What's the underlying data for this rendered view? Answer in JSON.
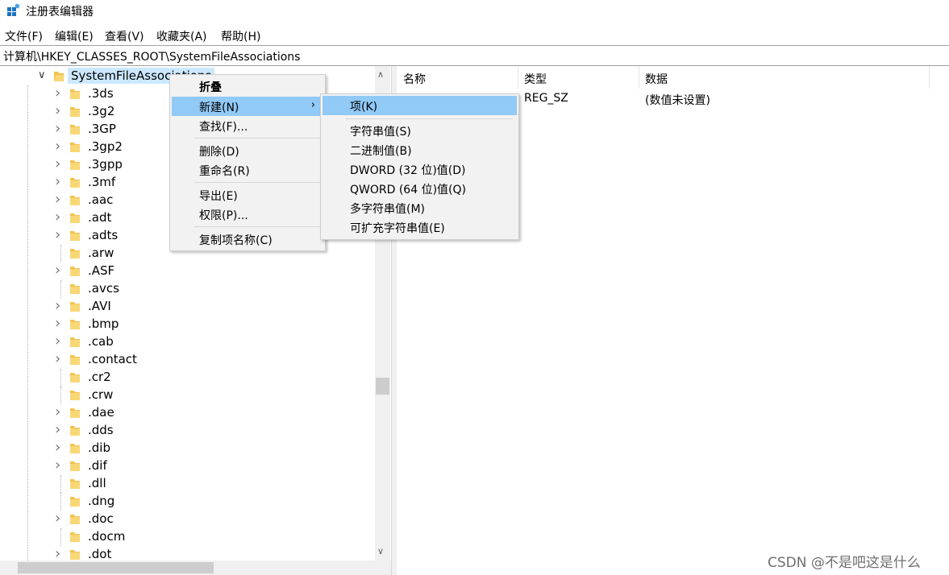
{
  "window": {
    "title": "注册表编辑器"
  },
  "menu": [
    {
      "label": "文件(F)"
    },
    {
      "label": "编辑(E)"
    },
    {
      "label": "查看(V)"
    },
    {
      "label": "收藏夹(A)"
    },
    {
      "label": "帮助(H)"
    }
  ],
  "address": "计算机\\HKEY_CLASSES_ROOT\\SystemFileAssociations",
  "tree": {
    "root_label": "SystemFileAssociations",
    "items": [
      {
        "label": ".3ds",
        "expandable": true
      },
      {
        "label": ".3g2",
        "expandable": true
      },
      {
        "label": ".3GP",
        "expandable": true
      },
      {
        "label": ".3gp2",
        "expandable": true
      },
      {
        "label": ".3gpp",
        "expandable": true
      },
      {
        "label": ".3mf",
        "expandable": true
      },
      {
        "label": ".aac",
        "expandable": true
      },
      {
        "label": ".adt",
        "expandable": true
      },
      {
        "label": ".adts",
        "expandable": true
      },
      {
        "label": ".arw",
        "expandable": false
      },
      {
        "label": ".ASF",
        "expandable": true
      },
      {
        "label": ".avcs",
        "expandable": false
      },
      {
        "label": ".AVI",
        "expandable": true
      },
      {
        "label": ".bmp",
        "expandable": true
      },
      {
        "label": ".cab",
        "expandable": true
      },
      {
        "label": ".contact",
        "expandable": true
      },
      {
        "label": ".cr2",
        "expandable": false
      },
      {
        "label": ".crw",
        "expandable": false
      },
      {
        "label": ".dae",
        "expandable": true
      },
      {
        "label": ".dds",
        "expandable": true
      },
      {
        "label": ".dib",
        "expandable": true
      },
      {
        "label": ".dif",
        "expandable": true
      },
      {
        "label": ".dll",
        "expandable": false
      },
      {
        "label": ".dng",
        "expandable": false
      },
      {
        "label": ".doc",
        "expandable": true
      },
      {
        "label": ".docm",
        "expandable": false
      },
      {
        "label": ".dot",
        "expandable": true
      }
    ]
  },
  "values_pane": {
    "headers": {
      "name": "名称",
      "type": "类型",
      "data": "数据"
    },
    "rows": [
      {
        "name": "",
        "type": "REG_SZ",
        "data": "(数值未设置)"
      }
    ]
  },
  "context_menu": {
    "collapse": "折叠",
    "new": "新建(N)",
    "find": "查找(F)...",
    "delete": "删除(D)",
    "rename": "重命名(R)",
    "export": "导出(E)",
    "permissions": "权限(P)...",
    "copy_key_name": "复制项名称(C)"
  },
  "submenu": {
    "key": "项(K)",
    "string": "字符串值(S)",
    "binary": "二进制值(B)",
    "dword": "DWORD (32 位)值(D)",
    "qword": "QWORD (64 位)值(Q)",
    "multi_string": "多字符串值(M)",
    "expandable_string": "可扩充字符串值(E)"
  },
  "watermark": "CSDN @不是吧这是什么",
  "colors": {
    "selection": "#cce8ff",
    "menu_highlight": "#91c9f7",
    "folder": "#f2c14e"
  }
}
